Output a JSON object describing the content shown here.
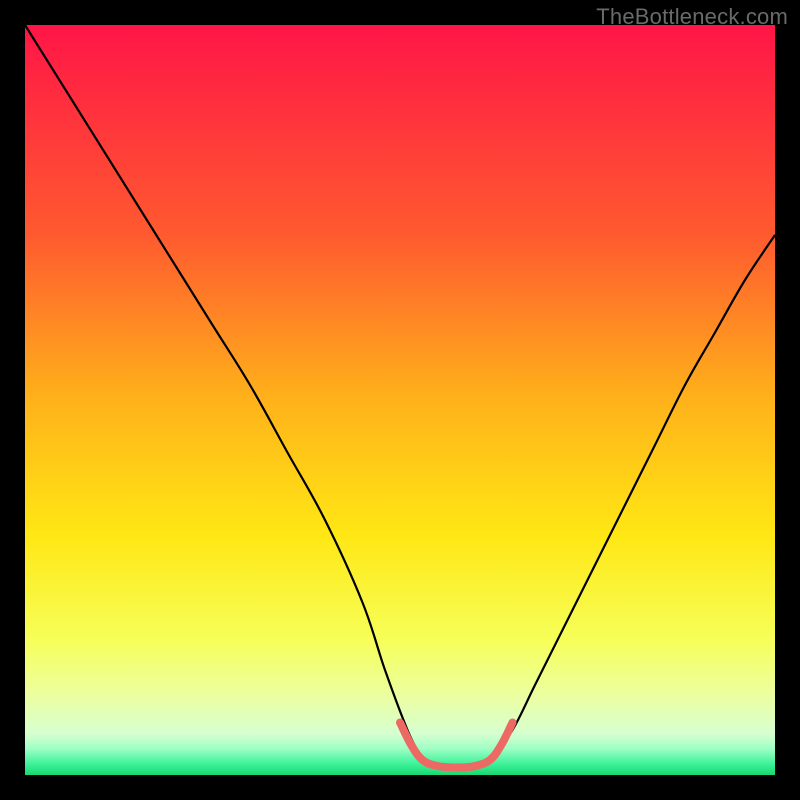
{
  "watermark": "TheBottleneck.com",
  "chart_data": {
    "type": "line",
    "title": "",
    "xlabel": "",
    "ylabel": "",
    "xlim": [
      0,
      100
    ],
    "ylim": [
      0,
      100
    ],
    "gradient_stops": [
      {
        "offset": 0,
        "color": "#ff1547"
      },
      {
        "offset": 0.28,
        "color": "#ff5a2f"
      },
      {
        "offset": 0.5,
        "color": "#ffb21a"
      },
      {
        "offset": 0.68,
        "color": "#ffe714"
      },
      {
        "offset": 0.82,
        "color": "#f6ff59"
      },
      {
        "offset": 0.9,
        "color": "#eaffa6"
      },
      {
        "offset": 0.945,
        "color": "#d6ffd0"
      },
      {
        "offset": 0.965,
        "color": "#9effc4"
      },
      {
        "offset": 0.985,
        "color": "#3ef29a"
      },
      {
        "offset": 1.0,
        "color": "#17d96e"
      }
    ],
    "series": [
      {
        "name": "left-curve",
        "stroke": "#000000",
        "width": 2.2,
        "x": [
          0,
          5,
          10,
          15,
          20,
          25,
          30,
          35,
          40,
          45,
          48,
          51,
          53
        ],
        "y": [
          100,
          92,
          84,
          76,
          68,
          60,
          52,
          43,
          34,
          23,
          14,
          6,
          2
        ]
      },
      {
        "name": "right-curve",
        "stroke": "#000000",
        "width": 2.2,
        "x": [
          62,
          65,
          68,
          72,
          76,
          80,
          84,
          88,
          92,
          96,
          100
        ],
        "y": [
          2,
          6,
          12,
          20,
          28,
          36,
          44,
          52,
          59,
          66,
          72
        ]
      },
      {
        "name": "bottom-highlight",
        "stroke": "#ec6a63",
        "width": 8,
        "linecap": "round",
        "x": [
          50,
          51.5,
          53,
          55,
          58,
          60,
          62,
          63.5,
          65
        ],
        "y": [
          7,
          4,
          2,
          1.2,
          1.0,
          1.2,
          2,
          4,
          7
        ]
      }
    ]
  }
}
